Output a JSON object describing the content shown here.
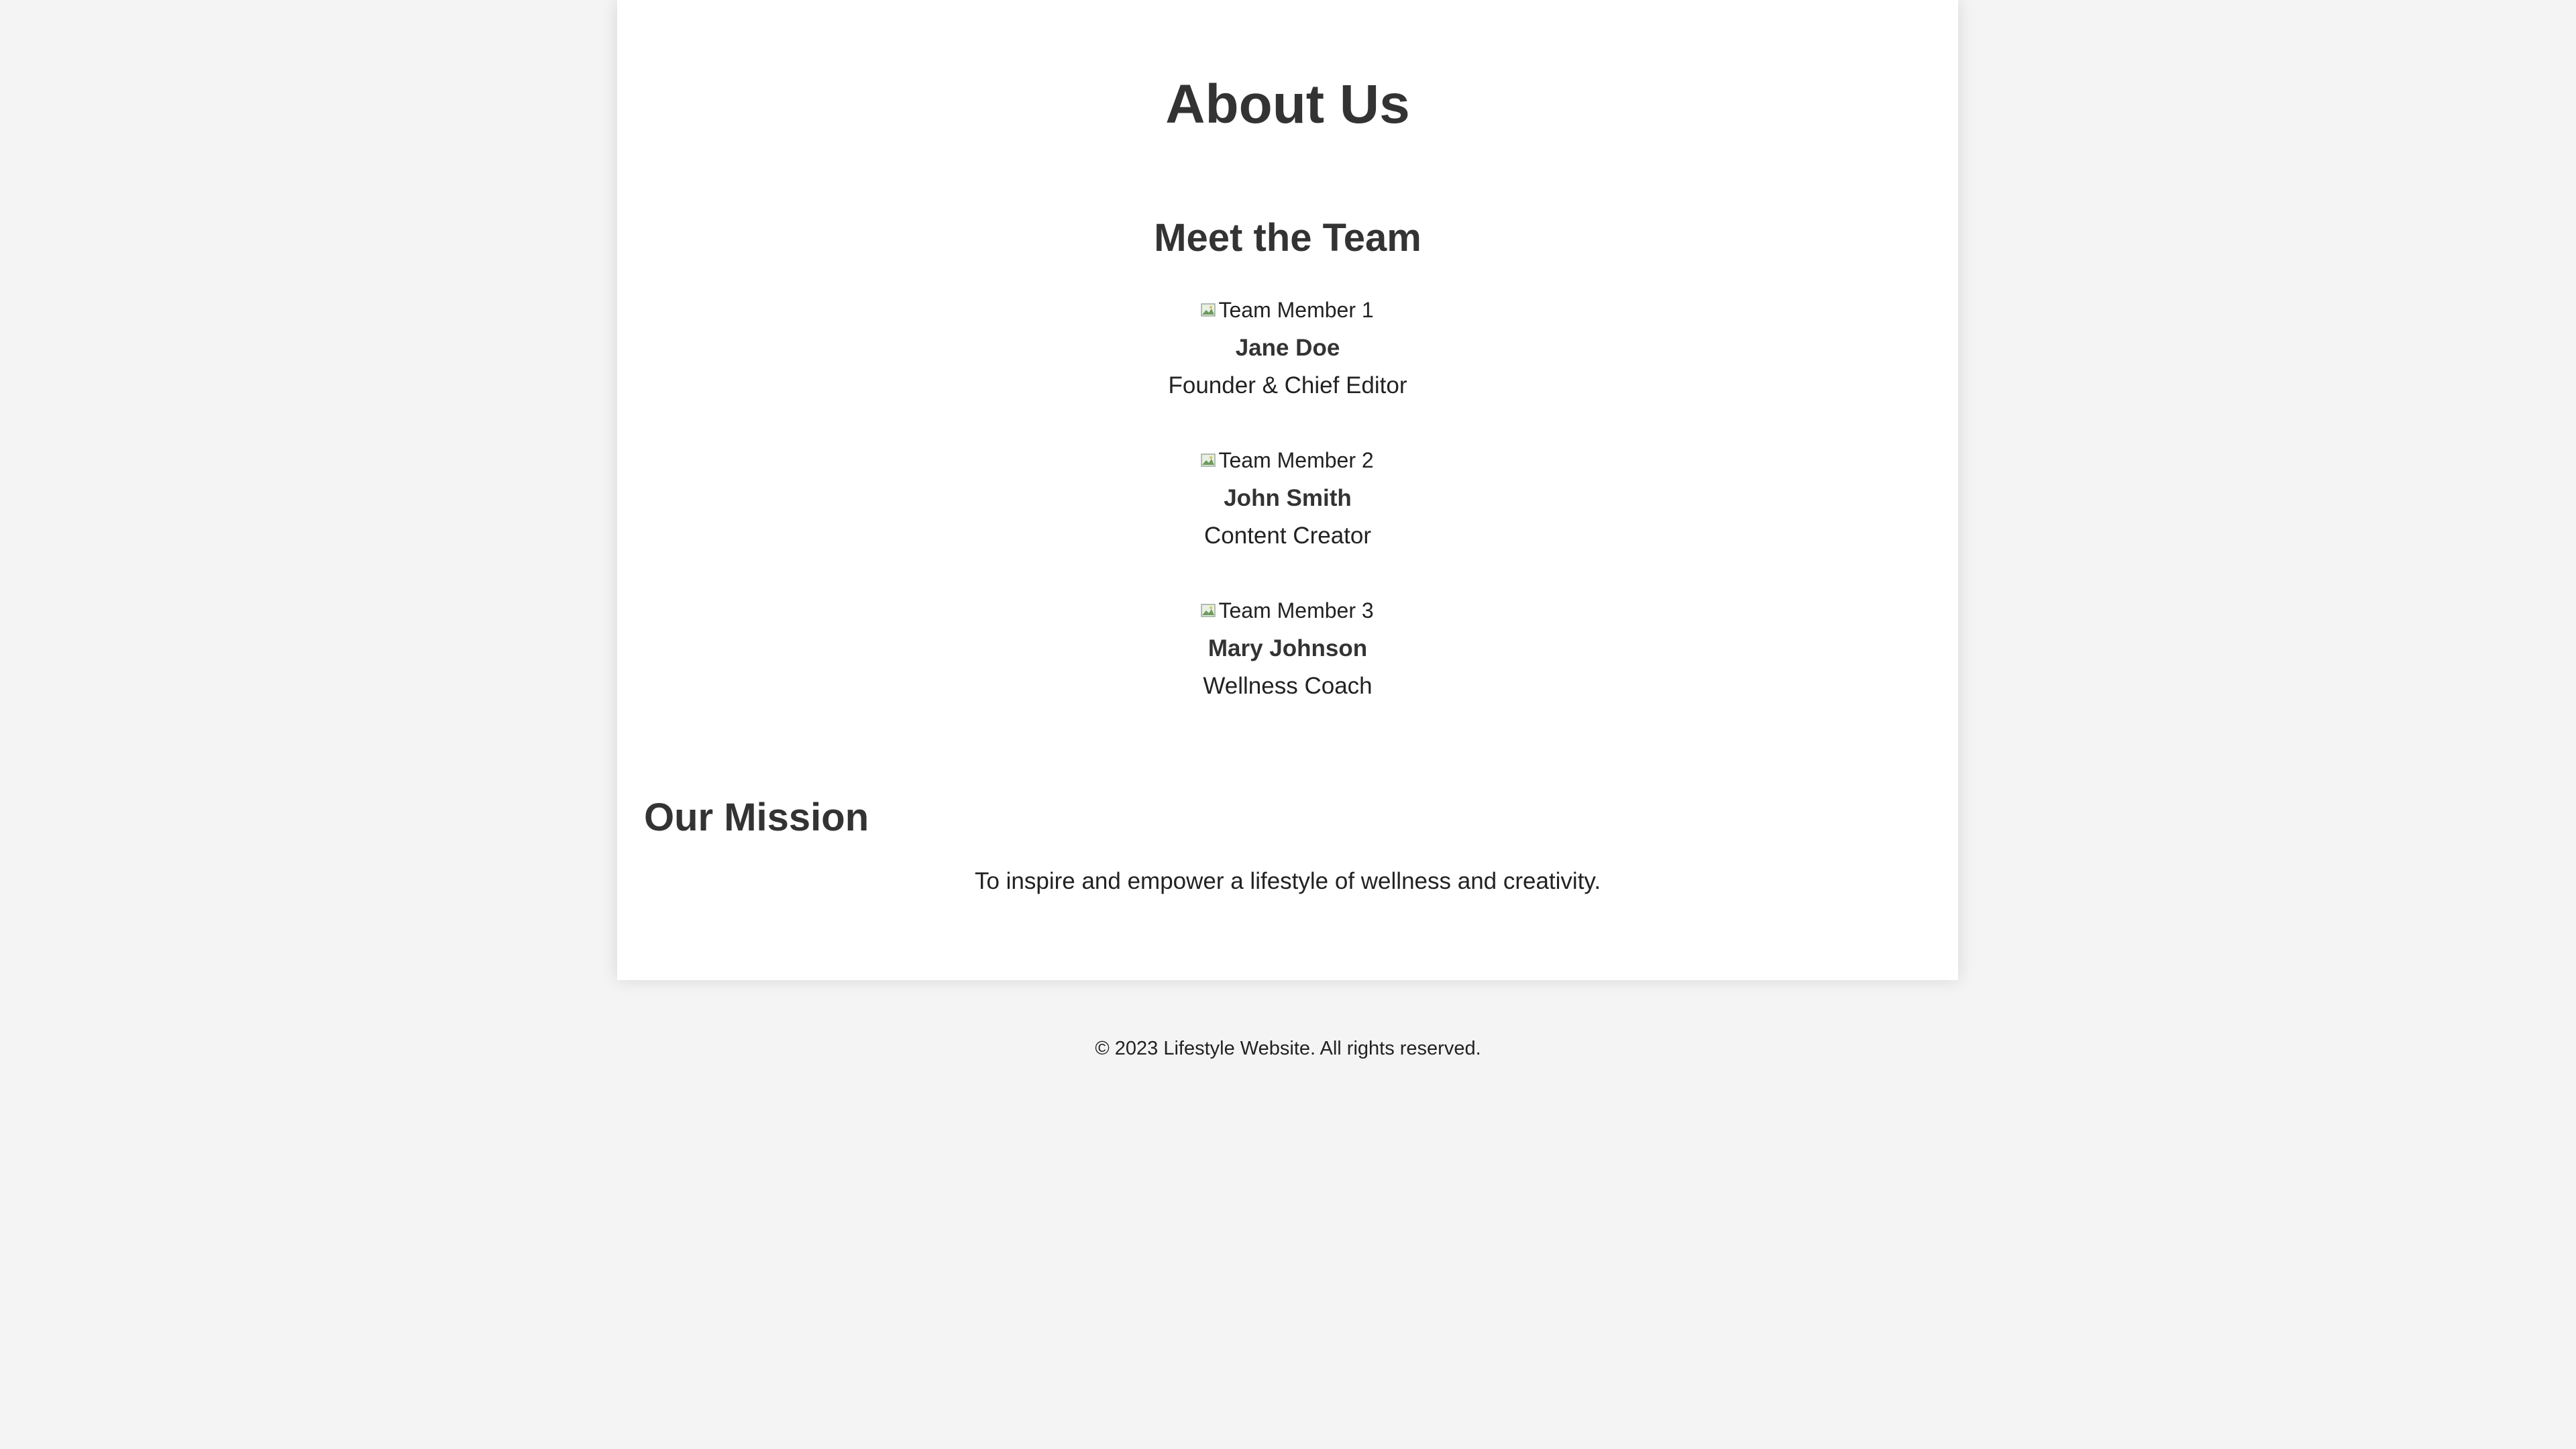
{
  "page": {
    "title": "About Us"
  },
  "team": {
    "heading": "Meet the Team",
    "members": [
      {
        "photo_alt": "Team Member 1",
        "name": "Jane Doe",
        "role": "Founder & Chief Editor"
      },
      {
        "photo_alt": "Team Member 2",
        "name": "John Smith",
        "role": "Content Creator"
      },
      {
        "photo_alt": "Team Member 3",
        "name": "Mary Johnson",
        "role": "Wellness Coach"
      }
    ]
  },
  "mission": {
    "heading": "Our Mission",
    "text": "To inspire and empower a lifestyle of wellness and creativity."
  },
  "footer": {
    "text": "© 2023 Lifestyle Website. All rights reserved."
  },
  "colors": {
    "page_background": "#f4f4f4",
    "card_background": "#ffffff",
    "heading_text": "#333333"
  },
  "icons": {
    "member_photo": "broken-image-icon"
  }
}
